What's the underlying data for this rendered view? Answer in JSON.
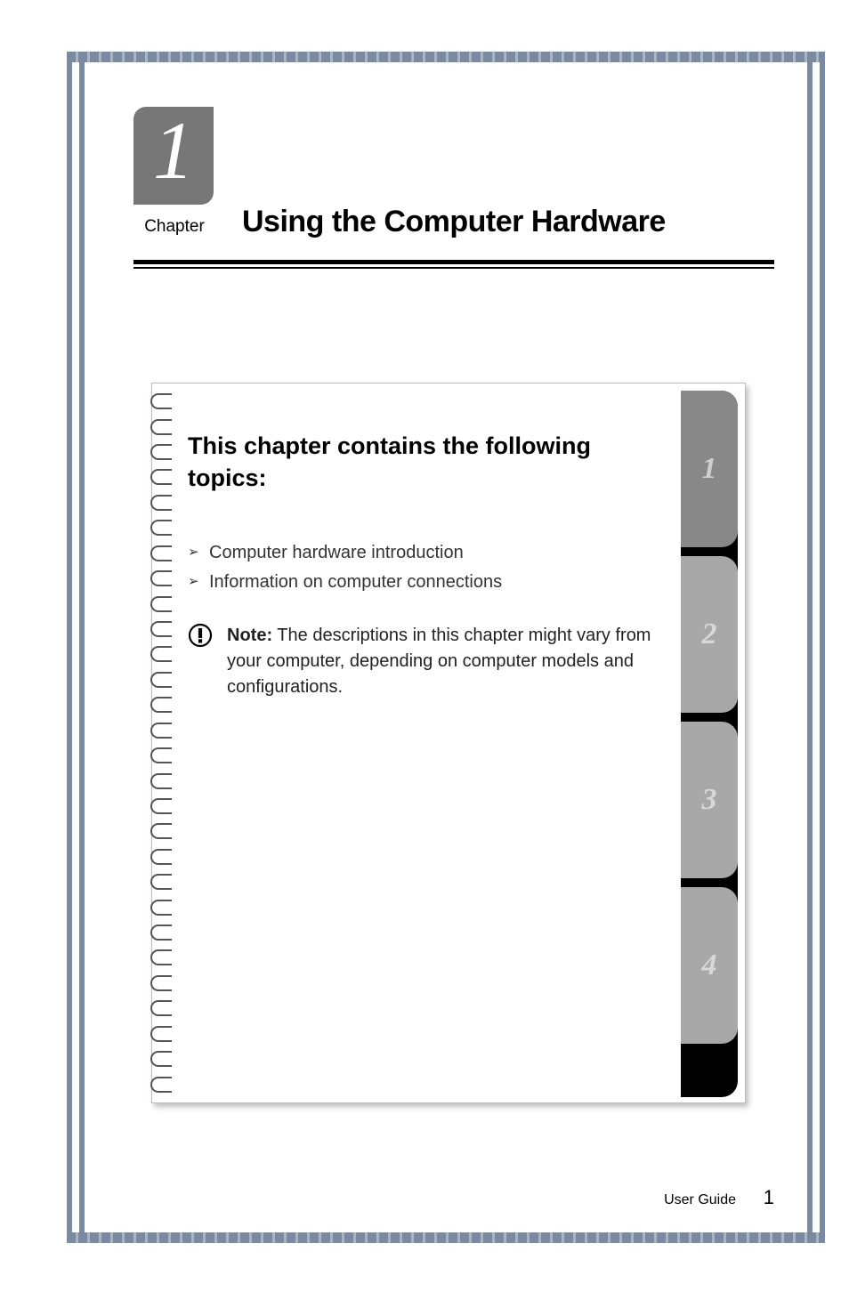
{
  "chapter": {
    "number": "1",
    "label": "Chapter",
    "title": "Using the Computer Hardware"
  },
  "content": {
    "heading": "This chapter contains the following topics:",
    "topics": [
      "Computer hardware introduction",
      "Information on computer connections"
    ],
    "note_prefix": "Note:",
    "note_body": " The descriptions in this chapter might vary from your computer, depending on computer models and configurations."
  },
  "tabs": [
    "1",
    "2",
    "3",
    "4"
  ],
  "footer": {
    "label": "User Guide",
    "page": "1"
  }
}
